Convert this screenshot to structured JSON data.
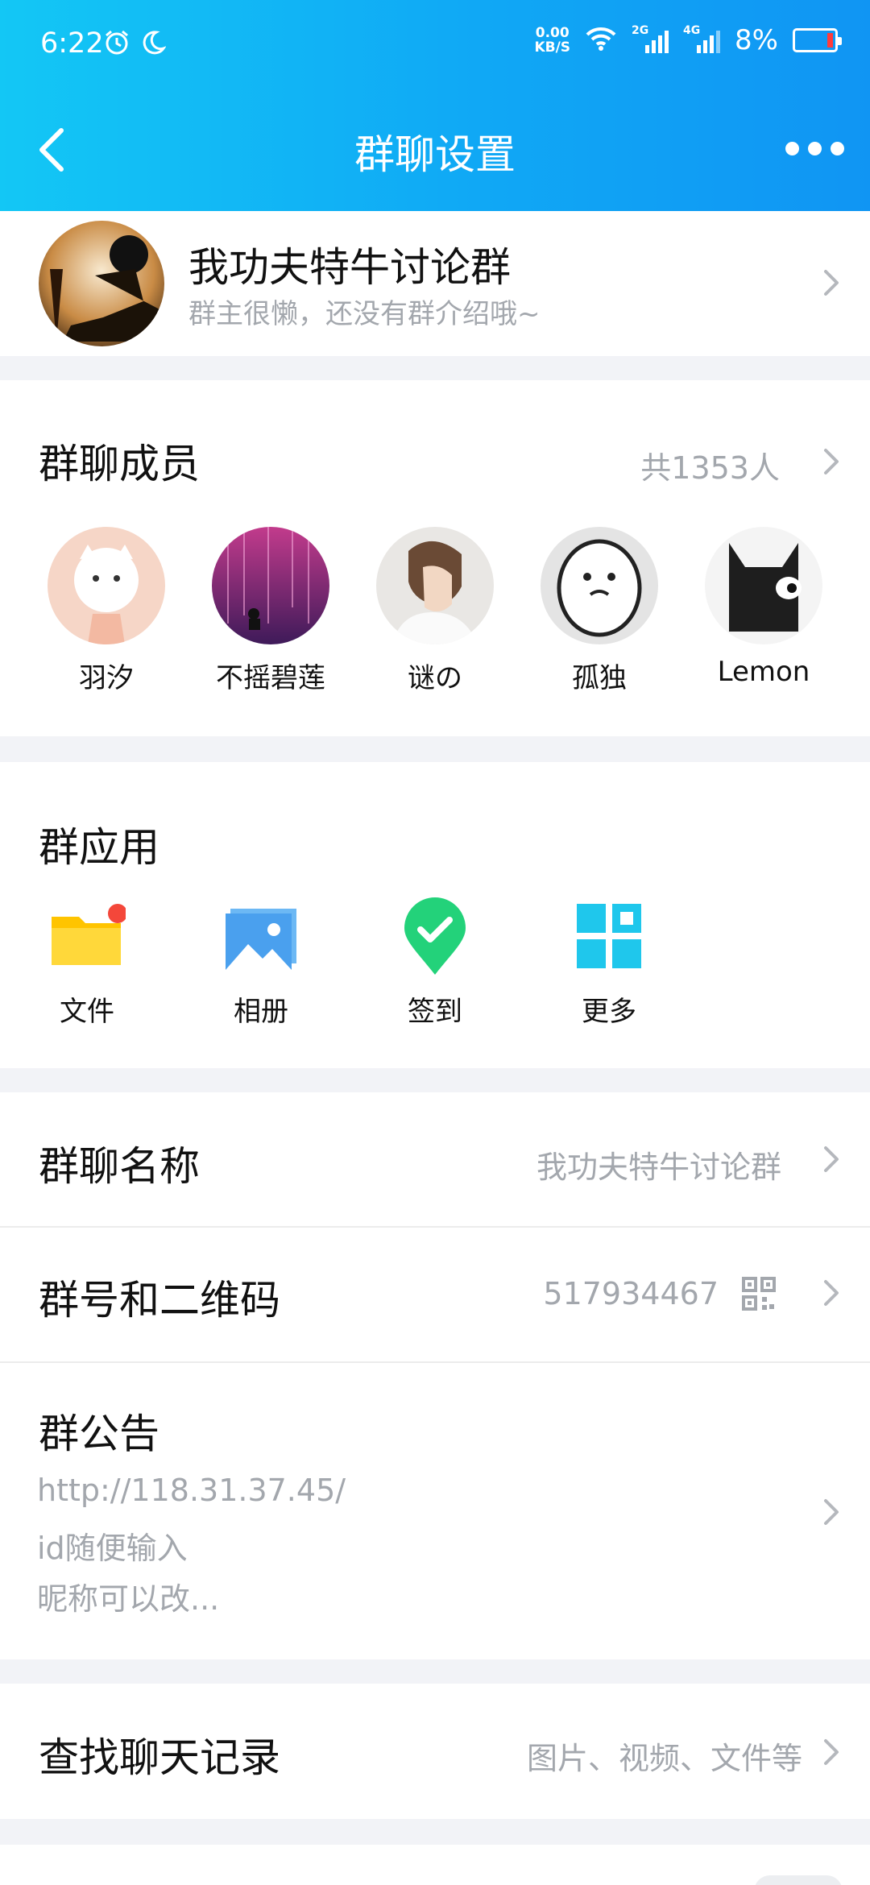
{
  "status": {
    "time": "6:22",
    "speed": "0.00",
    "speed_unit": "KB/S",
    "net1": "2G",
    "net2": "4G",
    "battery": "8%"
  },
  "nav": {
    "title": "群聊设置"
  },
  "group": {
    "name": "我功夫特牛讨论群",
    "description": "群主很懒，还没有群介绍哦~"
  },
  "members": {
    "title": "群聊成员",
    "count": "共1353人",
    "list": [
      {
        "name": "羽汐"
      },
      {
        "name": "不摇碧莲"
      },
      {
        "name": "谜の"
      },
      {
        "name": "孤独"
      },
      {
        "name": "Lemon"
      }
    ]
  },
  "apps": {
    "title": "群应用",
    "list": [
      {
        "name": "文件",
        "icon": "folder-icon"
      },
      {
        "name": "相册",
        "icon": "photo-album-icon"
      },
      {
        "name": "签到",
        "icon": "check-in-pin-icon"
      },
      {
        "name": "更多",
        "icon": "grid-more-icon"
      }
    ]
  },
  "settings": {
    "name_label": "群聊名称",
    "name_value": "我功夫特牛讨论群",
    "number_label": "群号和二维码",
    "number_value": "517934467",
    "notice_label": "群公告",
    "notice_lines": [
      "http://118.31.37.45/",
      "id随便输入",
      "昵称可以改..."
    ]
  },
  "search": {
    "label": "查找聊天记录",
    "value": "图片、视频、文件等"
  },
  "colors": {
    "header_start": "#13c7f5",
    "header_end": "#1095f3",
    "badge": "#f4473a",
    "secondary_text": "#a3a7ad"
  }
}
